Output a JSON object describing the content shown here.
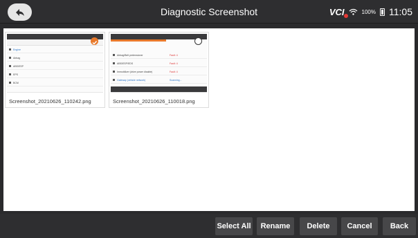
{
  "header": {
    "title": "Diagnostic Screenshot",
    "vci_label": "VCI",
    "battery_percent": "100%",
    "time": "11:05"
  },
  "thumbnails": [
    {
      "filename": "Screenshot_20210626_110242.png",
      "rows": [
        "Engine",
        "Airbag",
        "ABS/ESP",
        "EPS",
        "BCM"
      ]
    },
    {
      "filename": "Screenshot_20210626_110018.png",
      "rows": [
        {
          "label": "Airbag/Belt pretensioner",
          "value": "Fault: 4"
        },
        {
          "label": "ABS/ESP/EDS",
          "value": "Fault: 4"
        },
        {
          "label": "Immobilizer (drive power disable)",
          "value": "Fault: 4"
        },
        {
          "label": "Gateway (vehicle network)",
          "value": "Scanning..."
        }
      ]
    }
  ],
  "toolbar": {
    "select_all": "Select All",
    "rename": "Rename",
    "delete": "Delete",
    "cancel": "Cancel",
    "back": "Back"
  },
  "colors": {
    "bar_bg": "#2e2e30",
    "button_bg": "#474749",
    "accent_orange": "#e8792b",
    "vci_dot": "#e53935"
  }
}
